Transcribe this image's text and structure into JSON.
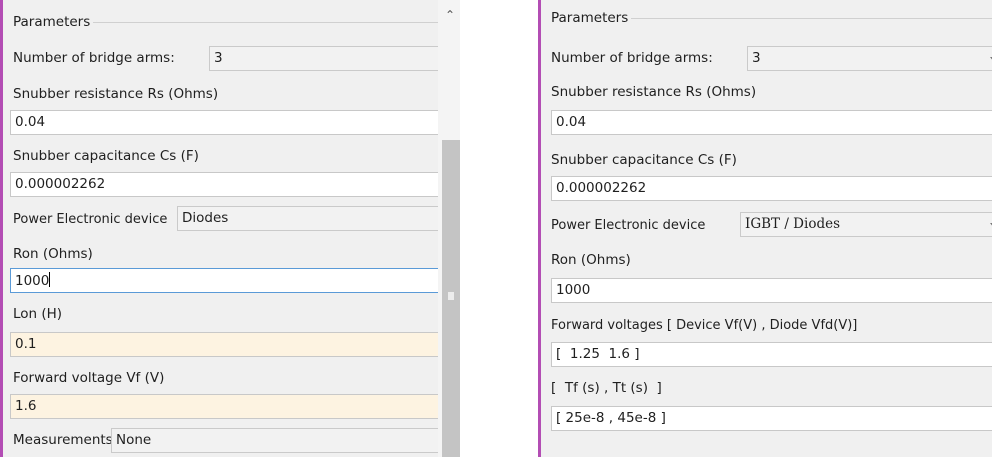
{
  "left": {
    "group_title": "Parameters",
    "bridge_arms_label": "Number of bridge arms:",
    "bridge_arms_value": "3",
    "rs_label": "Snubber resistance Rs (Ohms)",
    "rs_value": "0.04",
    "cs_label": "Snubber capacitance Cs (F)",
    "cs_value": "0.000002262",
    "device_label": "Power Electronic device",
    "device_value": "Diodes",
    "ron_label": "Ron (Ohms)",
    "ron_value": "1000",
    "lon_label": "Lon (H)",
    "lon_value": "0.1",
    "vf_label": "Forward voltage Vf (V)",
    "vf_value": "1.6",
    "meas_label": "Measurements",
    "meas_value": "None",
    "scroll_up_icon": "chevron-up-icon"
  },
  "right": {
    "group_title": "Parameters",
    "bridge_arms_label": "Number of bridge arms:",
    "bridge_arms_value": "3",
    "rs_label": "Snubber resistance Rs (Ohms)",
    "rs_value": "0.04",
    "cs_label": "Snubber capacitance Cs (F)",
    "cs_value": "0.000002262",
    "device_label": "Power Electronic device",
    "device_value": "IGBT / Diodes",
    "ron_label": "Ron (Ohms)",
    "ron_value": "1000",
    "fv_label": "Forward voltages  [ Device Vf(V) , Diode Vfd(V)]",
    "fv_value": "[  1.25  1.6 ]",
    "tf_label": "[  Tf (s) , Tt (s)  ]",
    "tf_value": "[ 25e-8 , 45e-8 ]"
  },
  "colors": {
    "accent_border": "#b34db4",
    "panel_bg": "#f0f0f0",
    "tinted_field_bg": "#fdf3e1",
    "focus_border": "#5a9ad7"
  }
}
